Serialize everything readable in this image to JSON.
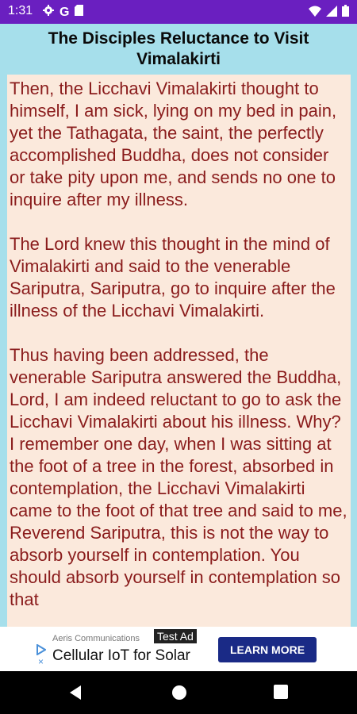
{
  "status_bar": {
    "time": "1:31",
    "left_icons": [
      "gear-icon",
      "google-icon",
      "sd-card-icon"
    ],
    "right_icons": [
      "wifi-icon",
      "signal-icon",
      "battery-icon"
    ],
    "google_letter": "G"
  },
  "colors": {
    "status_bar": "#6a1fc0",
    "app_background": "#a6dfeb",
    "content_background": "#fbe9dc",
    "body_text": "#8a1c1c",
    "ad_button": "#1a2a86"
  },
  "page": {
    "title": "The Disciples Reluctance to Visit Vimalakirti",
    "paragraphs": [
      "Then, the Licchavi Vimalakirti thought to himself, I am sick, lying on my bed in pain, yet the Tathagata, the saint, the perfectly accomplished Buddha, does not consider or take pity upon me, and sends no one to inquire after my illness.",
      "The Lord knew this thought in the mind of Vimalakirti and said to the venerable Sariputra, Sariputra, go to inquire after the illness of the Licchavi Vimalakirti.",
      "Thus having been addressed, the venerable Sariputra answered the Buddha, Lord, I am indeed reluctant to go to ask the Licchavi Vimalakirti about his illness. Why? I remember one day, when I was sitting at the foot of a tree in the forest, absorbed in contemplation, the Licchavi Vimalakirti came to the foot of that tree and said to me, Reverend Sariputra, this is not the way to absorb yourself in contemplation. You should absorb yourself in contemplation so that"
    ]
  },
  "ad": {
    "advertiser": "Aeris Communications",
    "test_label": "Test Ad",
    "headline": "Cellular IoT for Solar",
    "cta": "LEARN MORE",
    "close_glyph": "×"
  },
  "nav_bar": {
    "buttons": [
      "back-icon",
      "home-icon",
      "recents-icon"
    ]
  }
}
